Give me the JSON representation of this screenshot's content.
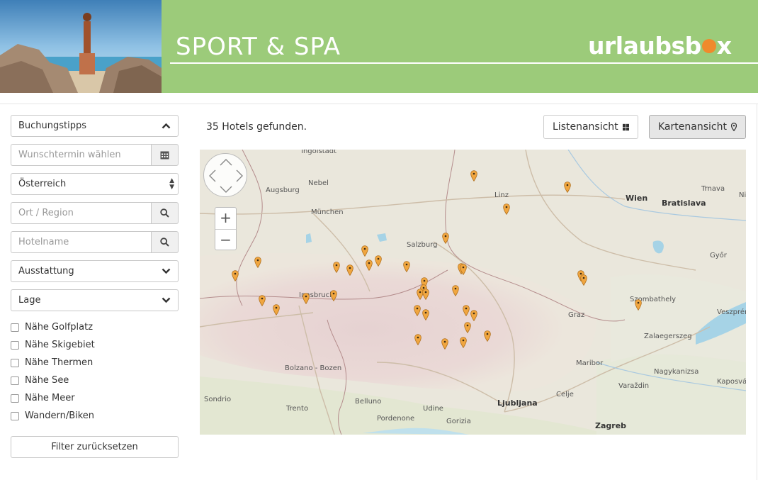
{
  "header": {
    "title": "SPORT & SPA",
    "logo_pre": "urlaubsb",
    "logo_post": "x"
  },
  "sidebar": {
    "booking_tips": "Buchungstipps",
    "date_placeholder": "Wunschtermin wählen",
    "country": "Österreich",
    "region_placeholder": "Ort / Region",
    "hotel_placeholder": "Hotelname",
    "amenities": "Ausstattung",
    "location": "Lage",
    "checks": [
      "Nähe Golfplatz",
      "Nähe Skigebiet",
      "Nähe Thermen",
      "Nähe See",
      "Nähe Meer",
      "Wandern/Biken"
    ],
    "reset": "Filter zurücksetzen"
  },
  "main": {
    "count": "35 Hotels gefunden.",
    "list_view": "Listenansicht",
    "map_view": "Kartenansicht"
  },
  "map": {
    "labels": [
      "Ingolstadt",
      "Augsburg",
      "Nebel",
      "München",
      "Linz",
      "Wien",
      "Bratislava",
      "Trnava",
      "Salzburg",
      "Győr",
      "Innsbruck",
      "Szombathely",
      "Graz",
      "Veszprém",
      "Zalaegerszeg",
      "Maribor",
      "Nagykanizsa",
      "Bolzano - Bozen",
      "Kaposvár",
      "Celje",
      "Varaždin",
      "Sondrio",
      "Trento",
      "Belluno",
      "Udine",
      "Ljubljana",
      "Pordenone",
      "Gorizia",
      "Zagreb",
      "Ni"
    ]
  },
  "colors": {
    "header_green": "#9ccb7a",
    "logo_orange": "#f08a2c",
    "pin_orange": "#f0a640"
  }
}
